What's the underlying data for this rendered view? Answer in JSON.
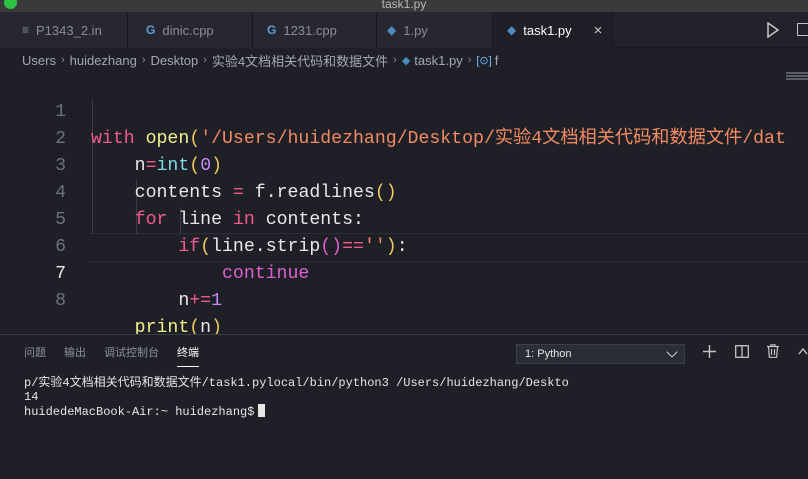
{
  "window": {
    "title": "task1.py"
  },
  "tabs": [
    {
      "label": "P1343_2.in",
      "icon": "file-icon"
    },
    {
      "label": "dinic.cpp",
      "icon": "cpp-icon"
    },
    {
      "label": "1231.cpp",
      "icon": "cpp-icon"
    },
    {
      "label": "1.py",
      "icon": "python-icon"
    },
    {
      "label": "task1.py",
      "icon": "python-icon",
      "active": true,
      "close": "×"
    }
  ],
  "breadcrumb": [
    "Users",
    "huidezhang",
    "Desktop",
    "实验4文档相关代码和数据文件",
    "task1.py",
    "f"
  ],
  "editor": {
    "line_numbers": [
      "1",
      "2",
      "3",
      "4",
      "5",
      "6",
      "7",
      "8"
    ],
    "current_line": "7"
  },
  "panel": {
    "tabs": [
      "问题",
      "输出",
      "调试控制台",
      "终端"
    ],
    "active_tab": "终端",
    "terminal_select": "1: Python",
    "terminal_lines": [
      "p/实验4文档相关代码和数据文件/task1.pylocal/bin/python3 /Users/huidezhang/Deskto",
      "14",
      "huidedeMacBook-Air:~ huidezhang$"
    ]
  },
  "colors": {
    "keyword": "#f35b8d",
    "string": "#f28b61",
    "function": "#f4ef8d",
    "number": "#c48bf2",
    "background": "#1e1f27"
  }
}
